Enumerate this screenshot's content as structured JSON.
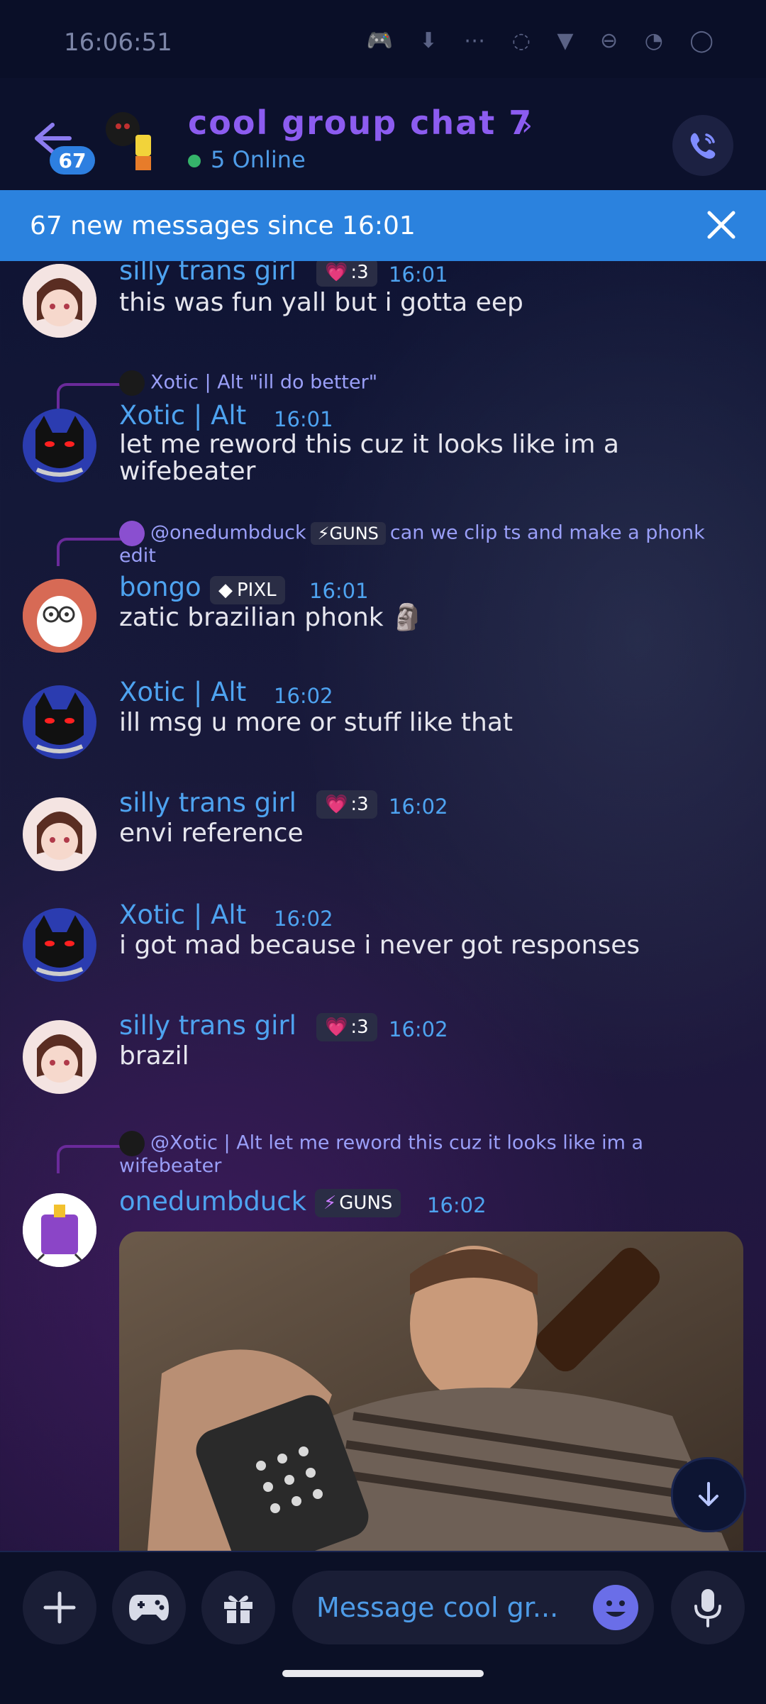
{
  "status_bar": {
    "time": "16:06:51",
    "icons": "🎮 ⬇ ⋯ ◌ ▼ ⊖ ◔ ◯"
  },
  "header": {
    "unread_count": "67",
    "title": "cool group chat 7",
    "online": "5 Online"
  },
  "banner": {
    "text": "67 new messages since 16:01"
  },
  "messages": [
    {
      "user": "silly trans girl",
      "tag": ":3",
      "time": "16:01",
      "text": "this was fun yall but i gotta eep"
    },
    {
      "reply": "Xotic | Alt \"ill do better\"",
      "user": "Xotic | Alt",
      "time": "16:01",
      "text": "let me reword this cuz it looks like im a wifebeater"
    },
    {
      "reply_user": "@onedumbduck",
      "reply_tag": "GUNS",
      "reply_text": "can we clip ts and make a phonk edit",
      "user": "bongo",
      "tag": "PIXL",
      "time": "16:01",
      "text": "zatic brazilian phonk 🗿"
    },
    {
      "user": "Xotic | Alt",
      "time": "16:02",
      "text": "ill msg u more or stuff like that"
    },
    {
      "user": "silly trans girl",
      "tag": ":3",
      "time": "16:02",
      "text": "envi reference"
    },
    {
      "user": "Xotic | Alt",
      "time": "16:02",
      "text": "i got mad because i never got responses"
    },
    {
      "user": "silly trans girl",
      "tag": ":3",
      "time": "16:02",
      "text": "brazil"
    },
    {
      "reply": "@Xotic | Alt let me reword this cuz it looks like im a wifebeater",
      "user": "onedumbduck",
      "tag": "GUNS",
      "time": "16:02"
    }
  ],
  "composer": {
    "placeholder": "Message cool gr..."
  },
  "colors": {
    "accent": "#8c5cf0",
    "blue": "#4ea3f0",
    "banner": "#2b82de"
  }
}
